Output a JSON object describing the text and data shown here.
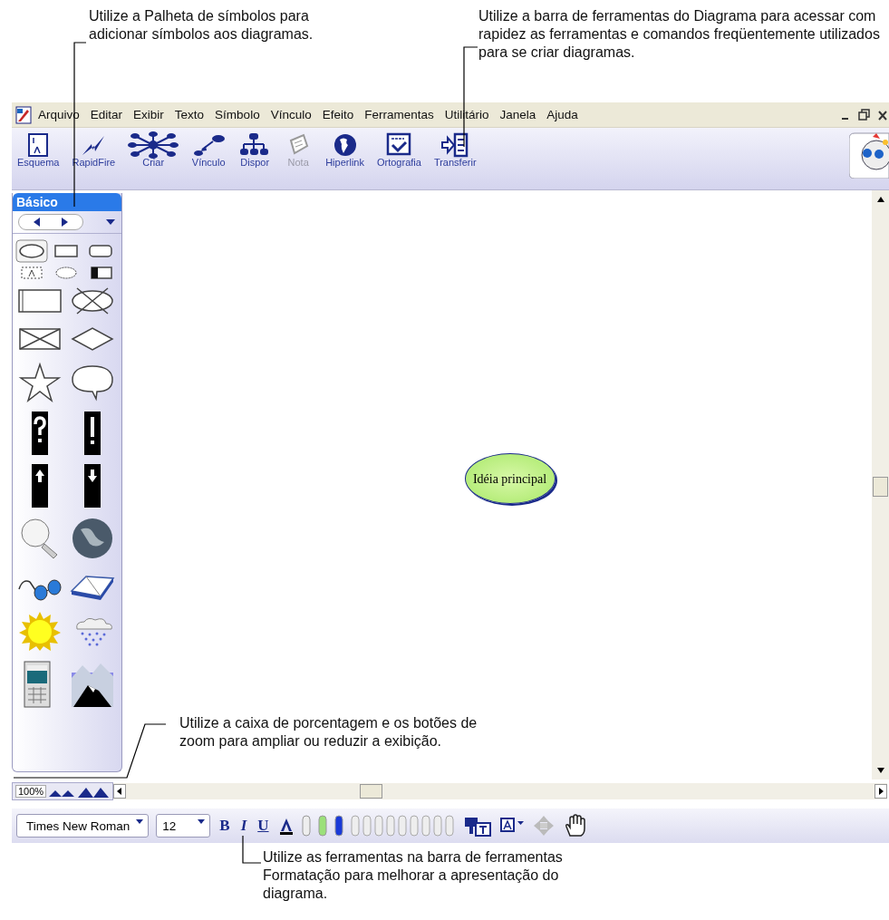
{
  "callouts": [
    {
      "text": "Utilize a Palheta de símbolos para adicionar símbolos aos diagramas."
    },
    {
      "text": "Utilize a barra de ferramentas do Diagrama para acessar com rapidez as ferramentas e comandos freqüentemente utilizados para se criar diagramas."
    },
    {
      "text": "Utilize a caixa de porcentagem e os botões de zoom para ampliar ou reduzir a exibição."
    },
    {
      "text": "Utilize as ferramentas na barra de ferramentas Formatação para melhorar a apresentação do diagrama."
    }
  ],
  "menu": [
    "Arquivo",
    "Editar",
    "Exibir",
    "Texto",
    "Símbolo",
    "Vínculo",
    "Efeito",
    "Ferramentas",
    "Utilitário",
    "Janela",
    "Ajuda"
  ],
  "toolbar": [
    {
      "label": "Esquema",
      "disabled": false
    },
    {
      "label": "RapidFire",
      "disabled": false
    },
    {
      "label": "Criar",
      "disabled": false
    },
    {
      "label": "Vínculo",
      "disabled": false
    },
    {
      "label": "Dispor",
      "disabled": false
    },
    {
      "label": "Nota",
      "disabled": true
    },
    {
      "label": "Hiperlink",
      "disabled": false
    },
    {
      "label": "Ortografia",
      "disabled": false
    },
    {
      "label": "Transferir",
      "disabled": false
    }
  ],
  "palette": {
    "title": "Básico"
  },
  "canvas": {
    "main_idea": "Idéia principal"
  },
  "zoom": {
    "percent": "100%"
  },
  "format_bar": {
    "font": "Times New Roman",
    "size": "12",
    "style_buttons": [
      "B",
      "I",
      "U"
    ]
  }
}
